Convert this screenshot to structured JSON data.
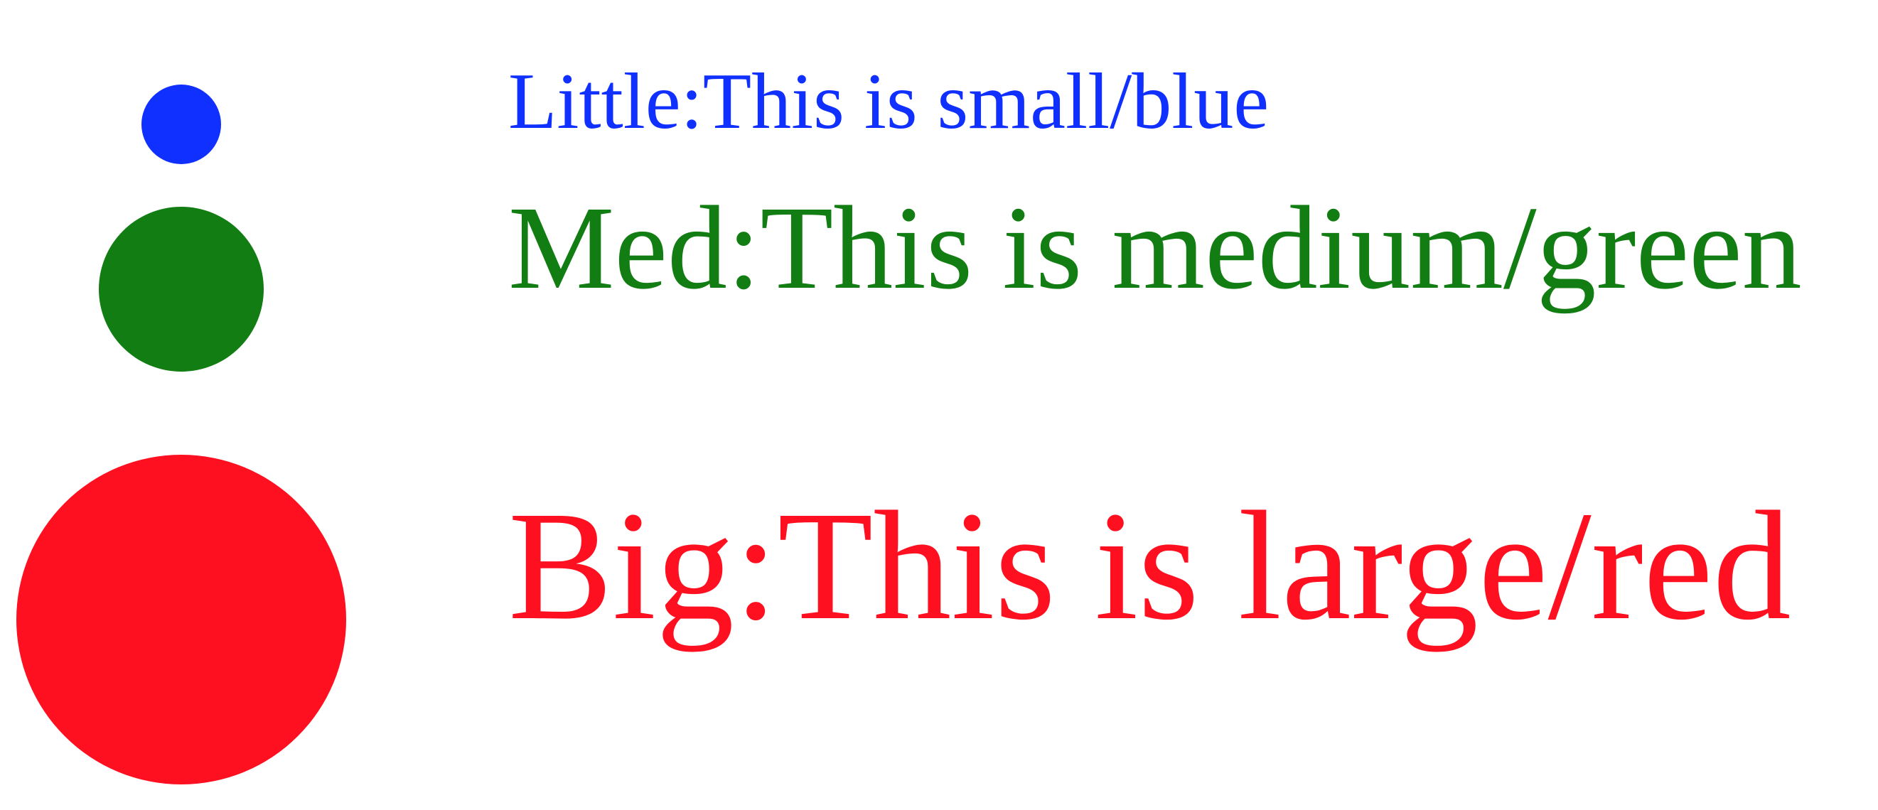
{
  "items": [
    {
      "label": "Little:This is small/blue",
      "color": "#1030ff"
    },
    {
      "label": "Med:This is medium/green",
      "color": "#127d12"
    },
    {
      "label": "Big:This is large/red",
      "color": "#ff1020"
    }
  ]
}
